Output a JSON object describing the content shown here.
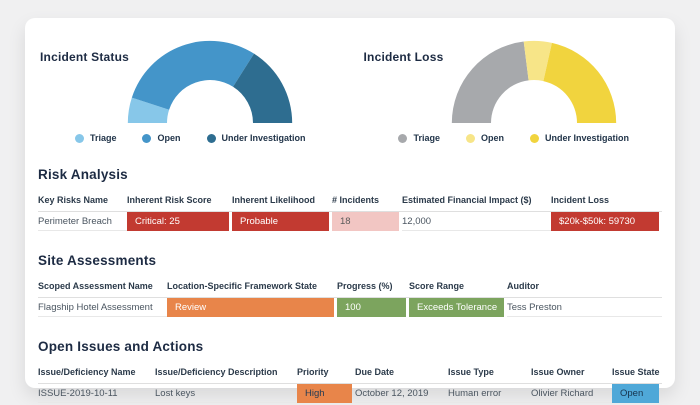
{
  "page": {
    "background": "#f0f0f1",
    "card_background": "#ffffff"
  },
  "chart_data": [
    {
      "type": "donut-semi",
      "title": "Incident Status",
      "legend_position": "bottom",
      "segments": [
        {
          "label": "Triage",
          "pct": 10,
          "color": "#87c7e9"
        },
        {
          "label": "Open",
          "pct": 58,
          "color": "#4495c9"
        },
        {
          "label": "Under Investigation",
          "pct": 32,
          "color": "#2e6d90"
        }
      ]
    },
    {
      "type": "donut-semi",
      "title": "Incident Loss",
      "legend_position": "bottom",
      "segments": [
        {
          "label": "Triage",
          "pct": 46,
          "color": "#a7a9ac"
        },
        {
          "label": "Open",
          "pct": 11,
          "color": "#f7e588"
        },
        {
          "label": "Under Investigation",
          "pct": 43,
          "color": "#f1d43e"
        }
      ]
    }
  ],
  "risk_analysis": {
    "title": "Risk Analysis",
    "columns": [
      "Key Risks Name",
      "Inherent Risk Score",
      "Inherent Likelihood",
      "# Incidents",
      "Estimated Financial Impact ($)",
      "Incident Loss"
    ],
    "row": {
      "name": "Perimeter Breach",
      "inherent_risk_score": "Critical: 25",
      "inherent_likelihood": "Probable",
      "incidents": "18",
      "estimated_financial_impact": "12,000",
      "incident_loss": "$20k-$50k: 59730"
    }
  },
  "site_assessments": {
    "title": "Site Assessments",
    "columns": [
      "Scoped Assessment Name",
      "Location-Specific Framework State",
      "Progress (%)",
      "Score Range",
      "Auditor"
    ],
    "row": {
      "name": "Flagship Hotel Assessment",
      "framework_state": "Review",
      "progress": "100",
      "score_range": "Exceeds Tolerance",
      "auditor": "Tess Preston"
    }
  },
  "open_issues": {
    "title": "Open Issues and Actions",
    "columns": [
      "Issue/Deficiency Name",
      "Issue/Deficiency Description",
      "Priority",
      "Due Date",
      "Issue Type",
      "Issue Owner",
      "Issue State"
    ],
    "row": {
      "name": "ISSUE-2019-10-11",
      "description": "Lost keys",
      "priority": "High",
      "due_date": "October 12, 2019",
      "issue_type": "Human error",
      "issue_owner": "Olivier Richard",
      "issue_state": "Open"
    }
  },
  "status_colors": {
    "critical_red": "#c23a31",
    "light_pink": "#f2c6c3",
    "warning_orange": "#e8854a",
    "ok_green": "#7ca45e",
    "open_blue": "#4fa8d8"
  }
}
